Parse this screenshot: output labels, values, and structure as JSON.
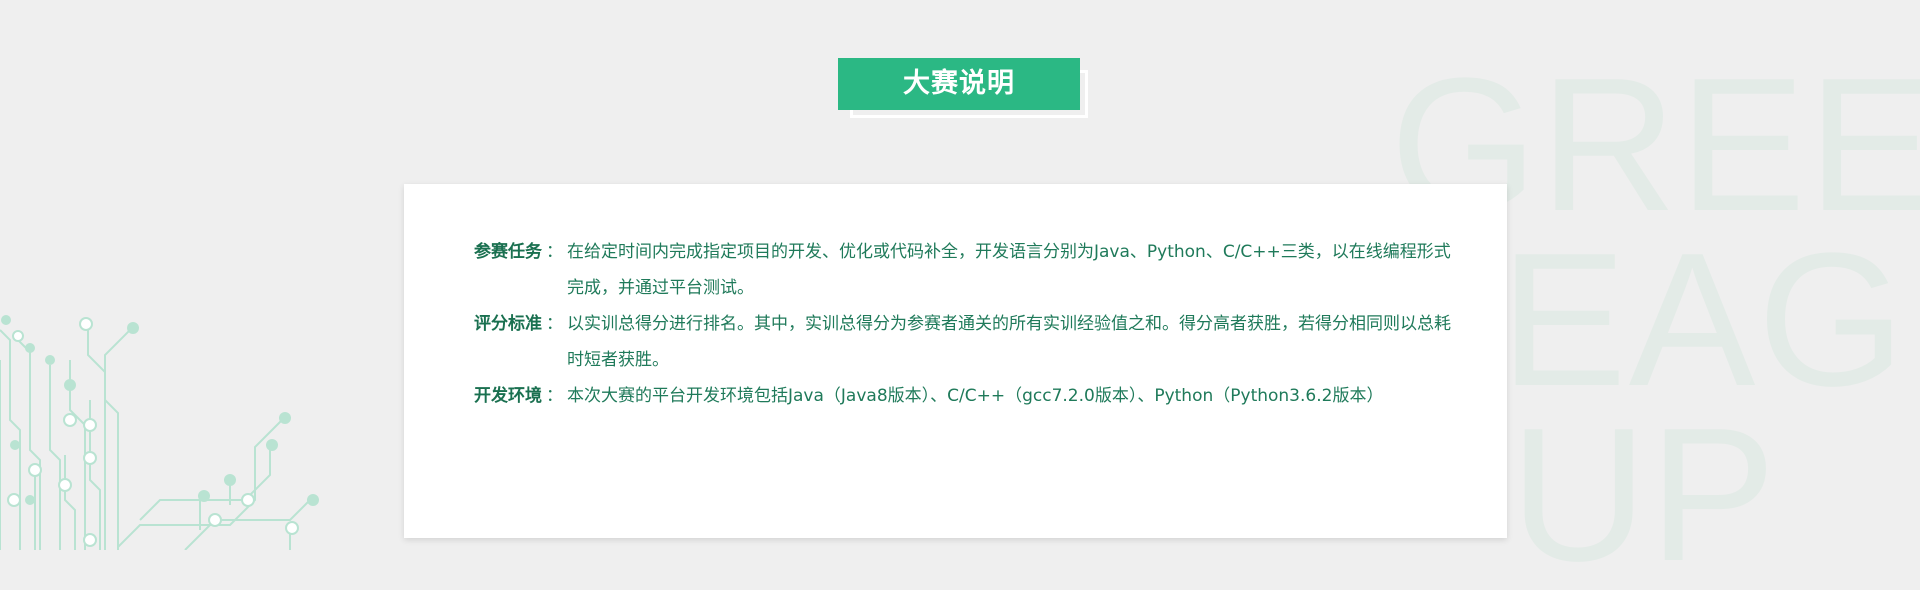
{
  "background": {
    "watermark_lines": [
      "GREEN",
      "EAGU",
      "UP"
    ],
    "colors": {
      "page_bg": "#efefef",
      "watermark": "#e3ebe7",
      "circuit": "#b9e3d2"
    }
  },
  "header": {
    "title": "大赛说明",
    "accent_color": "#2bb884"
  },
  "details": {
    "items": [
      {
        "label": "参赛任务",
        "colon": "：",
        "text": "在给定时间内完成指定项目的开发、优化或代码补全，开发语言分别为Java、Python、C/C++三类，以在线编程形式完成，并通过平台测试。"
      },
      {
        "label": "评分标准",
        "colon": "：",
        "text": "以实训总得分进行排名。其中，实训总得分为参赛者通关的所有实训经验值之和。得分高者获胜，若得分相同则以总耗时短者获胜。"
      },
      {
        "label": "开发环境",
        "colon": "：",
        "text": "本次大赛的平台开发环境包括Java（Java8版本）、C/C++（gcc7.2.0版本）、Python（Python3.6.2版本）"
      }
    ],
    "text_color": "#1f7a5a"
  }
}
